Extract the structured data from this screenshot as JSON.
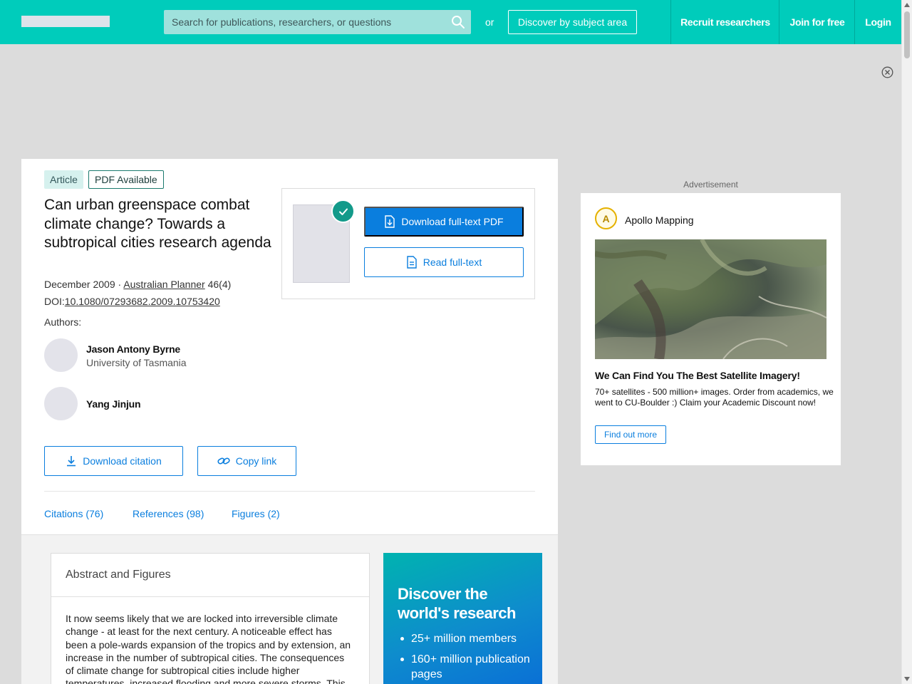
{
  "header": {
    "search_placeholder": "Search for publications, researchers, or questions",
    "or_label": "or",
    "discover_label": "Discover by subject area",
    "nav": {
      "recruit": "Recruit researchers",
      "join": "Join for free",
      "login": "Login"
    },
    "icons": {
      "search": "search-icon",
      "ad_close": "close-circle-icon"
    }
  },
  "article": {
    "badges": {
      "type": "Article",
      "pdf": "PDF Available"
    },
    "title": "Can urban greenspace combat climate change? Towards a subtropical cities research agenda",
    "date": "December 2009",
    "separator": " · ",
    "journal": "Australian Planner",
    "volume": " 46(4)",
    "doi_label": "DOI:",
    "doi": "10.1080/07293682.2009.10753420",
    "authors_label": "Authors:",
    "authors": [
      {
        "name": "Jason Antony Byrne",
        "institution": "University of Tasmania"
      },
      {
        "name": "Yang Jinjun",
        "institution": ""
      }
    ],
    "actions": {
      "download_citation": "Download citation",
      "copy_link": "Copy link",
      "download_pdf": "Download full-text PDF",
      "read_fulltext": "Read full-text"
    },
    "tabs": {
      "citations": "Citations (76)",
      "references": "References (98)",
      "figures": "Figures (2)"
    },
    "abstract_heading": "Abstract and Figures",
    "abstract_text": "It now seems likely that we are locked into irreversible climate change - at least for the next century. A noticeable effect has been a pole-wards expansion of the tropics and by extension, an increase in the number of subtropical cities. The consequences of climate change for subtropical cities include higher temperatures, increased flooding and more severe storms. This"
  },
  "promo": {
    "title": "Discover the world's research",
    "items": [
      "25+ million members",
      "160+ million publication pages"
    ]
  },
  "advert": {
    "label": "Advertisement",
    "logo_text": "A",
    "brand": "Apollo Mapping",
    "headline": "We Can Find You The Best Satellite Imagery!",
    "body": "70+ satellites - 500 million+ images. Order from academics, we went to CU-Boulder :) Claim your Academic Discount now!",
    "cta": "Find out more"
  },
  "colors": {
    "brand_teal": "#00ccbb",
    "link_blue": "#0a7ede",
    "check_green": "#139a8a"
  }
}
